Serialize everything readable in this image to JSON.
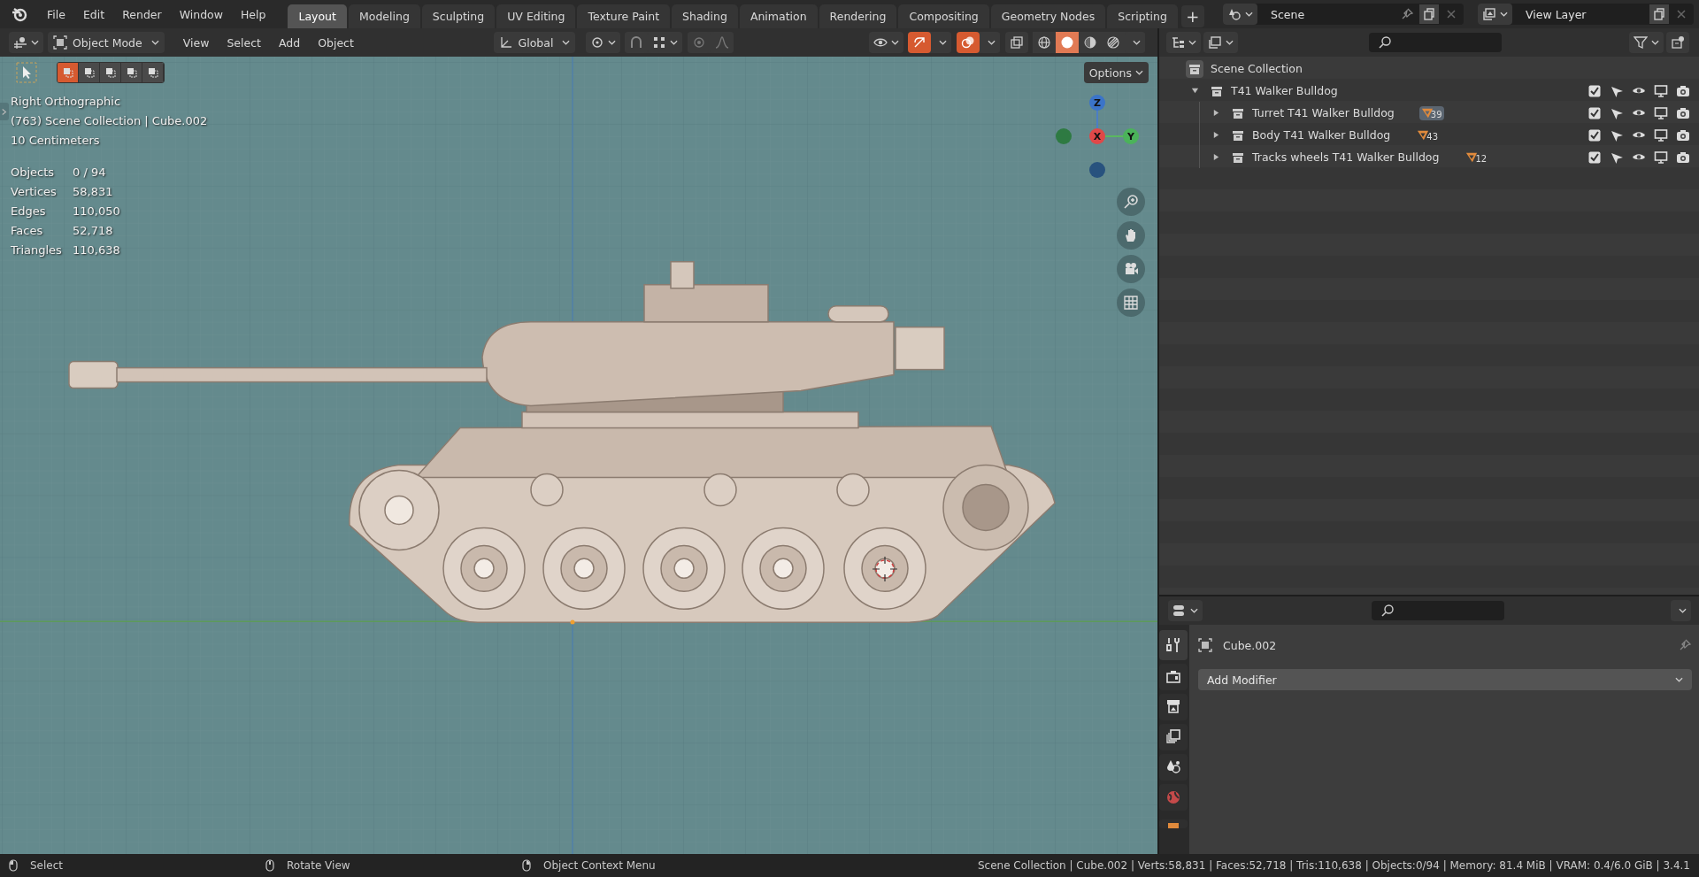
{
  "menu": [
    "File",
    "Edit",
    "Render",
    "Window",
    "Help"
  ],
  "workspace_tabs": [
    {
      "label": "Layout",
      "selected": true
    },
    {
      "label": "Modeling",
      "selected": false
    },
    {
      "label": "Sculpting",
      "selected": false
    },
    {
      "label": "UV Editing",
      "selected": false
    },
    {
      "label": "Texture Paint",
      "selected": false
    },
    {
      "label": "Shading",
      "selected": false
    },
    {
      "label": "Animation",
      "selected": false
    },
    {
      "label": "Rendering",
      "selected": false
    },
    {
      "label": "Compositing",
      "selected": false
    },
    {
      "label": "Geometry Nodes",
      "selected": false
    },
    {
      "label": "Scripting",
      "selected": false
    }
  ],
  "add_tab": "+",
  "scene": "Scene",
  "view_layer": "View Layer",
  "viewport": {
    "mode": "Object Mode",
    "menus": [
      "View",
      "Select",
      "Add",
      "Object"
    ],
    "orientation": "Global",
    "select_modes": [
      {
        "selected": true
      },
      {
        "selected": false
      },
      {
        "selected": false
      },
      {
        "selected": false
      },
      {
        "selected": false
      }
    ],
    "shading": [
      {
        "kind": "wireframe",
        "selected": false
      },
      {
        "kind": "solid",
        "selected": true
      },
      {
        "kind": "material",
        "selected": false
      },
      {
        "kind": "rendered",
        "selected": false
      }
    ],
    "options": "Options",
    "view_name": "Right Orthographic",
    "context": "(763) Scene Collection | Cube.002",
    "scale": "10 Centimeters",
    "stats": [
      {
        "label": "Objects",
        "value": "0 / 94"
      },
      {
        "label": "Vertices",
        "value": "58,831"
      },
      {
        "label": "Edges",
        "value": "110,050"
      },
      {
        "label": "Faces",
        "value": "52,718"
      },
      {
        "label": "Triangles",
        "value": "110,638"
      }
    ],
    "gizmo": {
      "z": "Z",
      "x": "X",
      "y": "Y"
    }
  },
  "outliner": {
    "root": "Scene Collection",
    "tree": [
      {
        "name": "T41 Walker Bulldog",
        "expanded": true,
        "checked": true,
        "children": [
          {
            "name": "Turret T41 Walker Bulldog",
            "expanded": false,
            "checked": true,
            "count": "39",
            "active": true
          },
          {
            "name": "Body T41 Walker Bulldog",
            "expanded": false,
            "checked": true,
            "count": "43",
            "active": false
          },
          {
            "name": "Tracks wheels T41 Walker Bulldog",
            "expanded": false,
            "checked": true,
            "count": "12",
            "active": false
          }
        ]
      }
    ]
  },
  "properties": {
    "object": "Cube.002",
    "add_modifier": "Add Modifier"
  },
  "status_bar": {
    "hints": [
      "Select",
      "Rotate View",
      "Object Context Menu"
    ],
    "info": "Scene Collection | Cube.002 | Verts:58,831 | Faces:52,718 | Tris:110,638 | Objects:0/94 | Memory: 81.4 MiB | VRAM: 0.4/6.0 GiB | 3.4.1"
  }
}
